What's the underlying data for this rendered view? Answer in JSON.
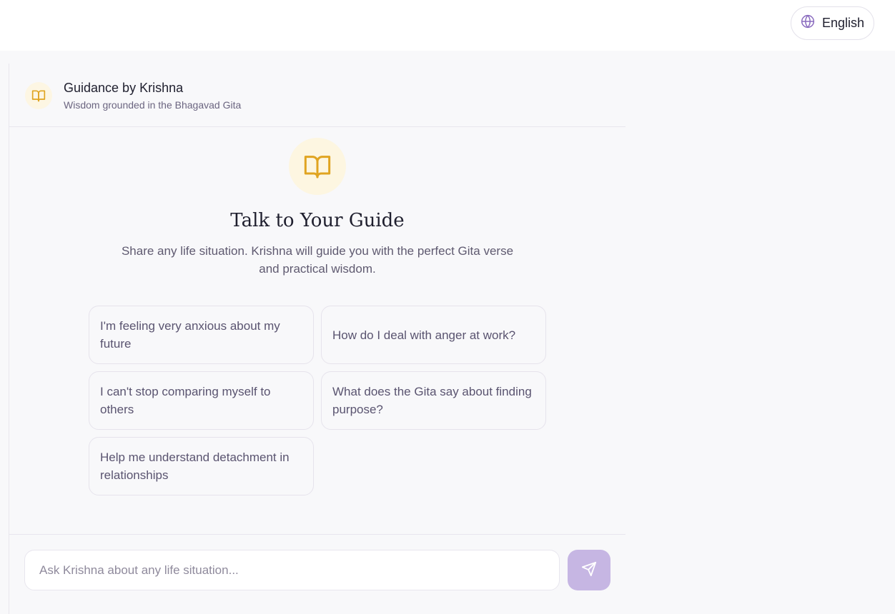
{
  "topbar": {
    "language_label": "English",
    "icon": "globe-icon"
  },
  "header": {
    "icon": "book-icon",
    "title": "Guidance by Krishna",
    "subtitle": "Wisdom grounded in the Bhagavad Gita"
  },
  "hero": {
    "icon": "book-open-icon",
    "title": "Talk to Your Guide",
    "description": "Share any life situation. Krishna will guide you with the perfect Gita verse and practical wisdom."
  },
  "suggestions": [
    "I'm feeling very anxious about my future",
    "How do I deal with anger at work?",
    "I can't stop comparing myself to others",
    "What does the Gita say about finding purpose?",
    "Help me understand detachment in relationships"
  ],
  "composer": {
    "placeholder": "Ask Krishna about any life situation...",
    "value": "",
    "send_icon": "send-icon"
  },
  "colors": {
    "accent": "#c6b6e3",
    "gold": "#e0a421",
    "globe": "#8a6bbf"
  }
}
